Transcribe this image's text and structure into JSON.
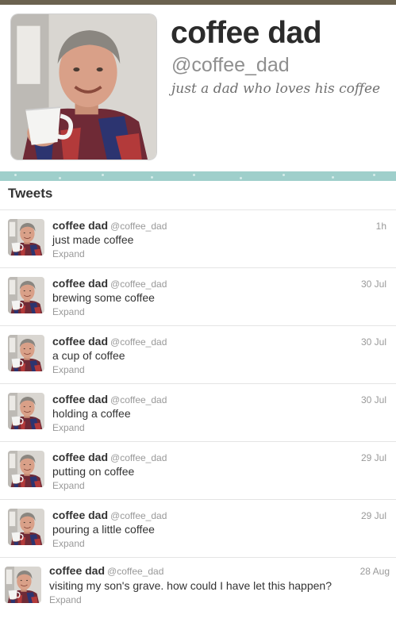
{
  "profile": {
    "name": "coffee dad",
    "handle": "@coffee_dad",
    "bio": "just a dad who loves his coffee"
  },
  "colors": {
    "top_bar": "#6b624f",
    "stripe": "#9fcfcb",
    "text_dark": "#333333",
    "text_muted": "#999999"
  },
  "timeline": {
    "heading": "Tweets",
    "tweets": [
      {
        "name": "coffee dad",
        "handle": "@coffee_dad",
        "time": "1h",
        "text": "just made coffee",
        "expand": "Expand"
      },
      {
        "name": "coffee dad",
        "handle": "@coffee_dad",
        "time": "30 Jul",
        "text": "brewing some coffee",
        "expand": "Expand"
      },
      {
        "name": "coffee dad",
        "handle": "@coffee_dad",
        "time": "30 Jul",
        "text": "a cup of coffee",
        "expand": "Expand"
      },
      {
        "name": "coffee dad",
        "handle": "@coffee_dad",
        "time": "30 Jul",
        "text": "holding a coffee",
        "expand": "Expand"
      },
      {
        "name": "coffee dad",
        "handle": "@coffee_dad",
        "time": "29 Jul",
        "text": "putting on coffee",
        "expand": "Expand"
      },
      {
        "name": "coffee dad",
        "handle": "@coffee_dad",
        "time": "29 Jul",
        "text": "pouring a little coffee",
        "expand": "Expand"
      },
      {
        "name": "coffee dad",
        "handle": "@coffee_dad",
        "time": "28 Aug",
        "text": "visiting my son's grave. how could I have let this happen?",
        "expand": "Expand"
      }
    ]
  }
}
